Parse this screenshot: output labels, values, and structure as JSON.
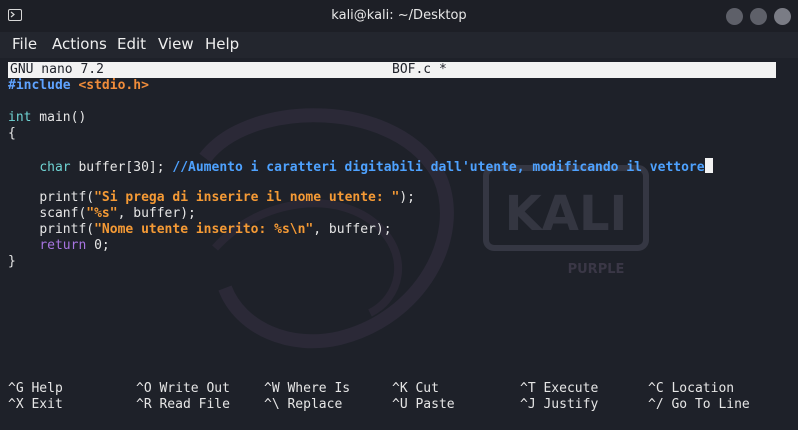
{
  "window": {
    "title": "kali@kali: ~/Desktop"
  },
  "menu": {
    "items": [
      "File",
      "Actions",
      "Edit",
      "View",
      "Help"
    ]
  },
  "nano": {
    "version": "GNU nano 7.2",
    "filename": "BOF.c *"
  },
  "code": {
    "l1_directive": "#include",
    "l1_header": "<stdio.h>",
    "l3_type": "int",
    "l3_rest": " main()",
    "l4": "{",
    "l6_type": "char",
    "l6_rest": " buffer[30]; ",
    "l6_comment": "//Aumento i caratteri digitabili dall'utente, modificando il vettore",
    "l8_fn": "printf(",
    "l8_str": "\"Si prega di inserire il nome utente: \"",
    "l8_end": ");",
    "l9_fn": "scanf(",
    "l9_str": "\"%s\"",
    "l9_end": ", buffer);",
    "l10_fn": "printf(",
    "l10_str": "\"Nome utente inserito: %s\\n\"",
    "l10_end": ", buffer);",
    "l11_kw": "return",
    "l11_rest": " 0;",
    "l12": "}"
  },
  "shortcuts": [
    {
      "key": "^G",
      "label": "Help"
    },
    {
      "key": "^O",
      "label": "Write Out"
    },
    {
      "key": "^W",
      "label": "Where Is"
    },
    {
      "key": "^K",
      "label": "Cut"
    },
    {
      "key": "^T",
      "label": "Execute"
    },
    {
      "key": "^C",
      "label": "Location"
    },
    {
      "key": "^X",
      "label": "Exit"
    },
    {
      "key": "^R",
      "label": "Read File"
    },
    {
      "key": "^\\",
      "label": "Replace"
    },
    {
      "key": "^U",
      "label": "Paste"
    },
    {
      "key": "^J",
      "label": "Justify"
    },
    {
      "key": "^/",
      "label": "Go To Line"
    }
  ],
  "watermark": {
    "word1": "KALI",
    "word2": "PURPLE"
  },
  "colors": {
    "terminal_bg": "#1e2129",
    "titlebar_bg": "#1d1f26",
    "string": "#f59a35",
    "comment": "#4ea2ff",
    "keyword": "#a774e0",
    "type": "#6fd3d3"
  }
}
